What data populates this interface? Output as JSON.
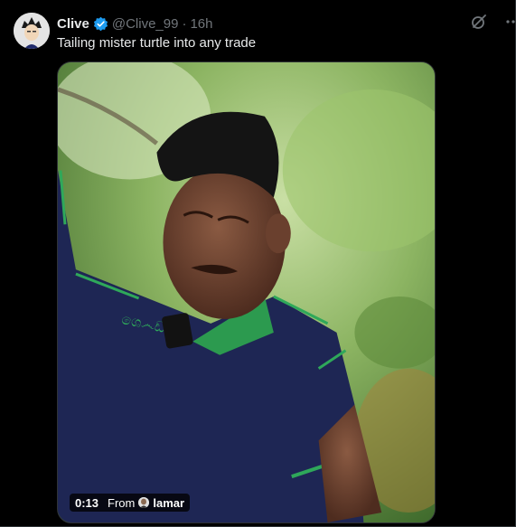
{
  "tweet": {
    "author": {
      "display_name": "Clive",
      "handle": "@Clive_99",
      "separator": "·",
      "time": "16h",
      "verified": true
    },
    "text": "Tailing mister turtle into any trade",
    "icons": {
      "avatar": "profile-avatar",
      "verified": "verified-badge-icon",
      "grok": "grok-icon",
      "more": "more-icon"
    },
    "media": {
      "type": "video",
      "duration": "0:13",
      "from_label": "From",
      "source_name": "lamar"
    }
  },
  "colors": {
    "background": "#000000",
    "text_primary": "#e7e9ea",
    "text_secondary": "#71767b",
    "verified_blue": "#1d9bf0",
    "border": "#2f3336"
  }
}
